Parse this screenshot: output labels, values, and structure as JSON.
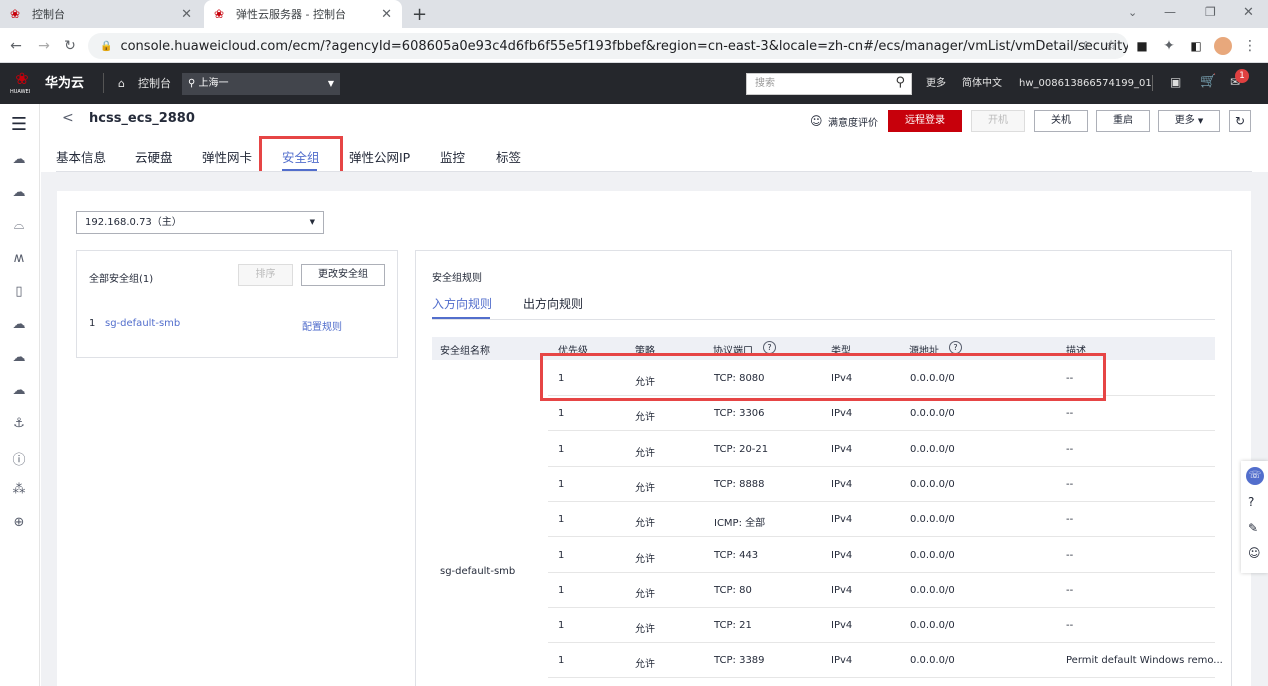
{
  "browser": {
    "tabs": [
      {
        "title": "控制台"
      },
      {
        "title": "弹性云服务器 - 控制台"
      }
    ],
    "url": "console.huaweicloud.com/ecm/?agencyId=608605a0e93c4d6fb6f55e5f193fbbef&region=cn-east-3&locale=zh-cn#/ecs/manager/vmList/vmDetail/securitygroups?instanc..."
  },
  "topnav": {
    "logo_text": "华为云",
    "logo_sub": "HUAWEI",
    "console": "控制台",
    "region": "上海一",
    "search_placeholder": "搜索",
    "more": "更多",
    "language": "简体中文",
    "username": "hw_008613866574199_01",
    "notif_count": "1"
  },
  "header": {
    "back": "<",
    "title": "hcss_ecs_2880",
    "satisfaction": "满意度评价",
    "remote_login": "远程登录",
    "power_on": "开机",
    "power_off": "关机",
    "restart": "重启",
    "more": "更多"
  },
  "tabs": [
    "基本信息",
    "云硬盘",
    "弹性网卡",
    "安全组",
    "弹性公网IP",
    "监控",
    "标签"
  ],
  "active_tab": "安全组",
  "nic_select": "192.168.0.73（主）",
  "left_panel": {
    "title": "全部安全组(1)",
    "sort_btn": "排序",
    "change_btn": "更改安全组",
    "group_index": "1",
    "group_name": "sg-default-smb",
    "config_link": "配置规则"
  },
  "rules_panel": {
    "title": "安全组规则",
    "tab_inbound": "入方向规则",
    "tab_outbound": "出方向规则",
    "columns": [
      "安全组名称",
      "优先级",
      "策略",
      "协议端口",
      "类型",
      "源地址",
      "描述"
    ],
    "group_name": "sg-default-smb",
    "rows": [
      {
        "priority": "1",
        "policy": "允许",
        "port": "TCP: 8080",
        "type": "IPv4",
        "source": "0.0.0.0/0",
        "desc": "--"
      },
      {
        "priority": "1",
        "policy": "允许",
        "port": "TCP: 3306",
        "type": "IPv4",
        "source": "0.0.0.0/0",
        "desc": "--"
      },
      {
        "priority": "1",
        "policy": "允许",
        "port": "TCP: 20-21",
        "type": "IPv4",
        "source": "0.0.0.0/0",
        "desc": "--"
      },
      {
        "priority": "1",
        "policy": "允许",
        "port": "TCP: 8888",
        "type": "IPv4",
        "source": "0.0.0.0/0",
        "desc": "--"
      },
      {
        "priority": "1",
        "policy": "允许",
        "port": "ICMP: 全部",
        "type": "IPv4",
        "source": "0.0.0.0/0",
        "desc": "--"
      },
      {
        "priority": "1",
        "policy": "允许",
        "port": "TCP: 443",
        "type": "IPv4",
        "source": "0.0.0.0/0",
        "desc": "--"
      },
      {
        "priority": "1",
        "policy": "允许",
        "port": "TCP: 80",
        "type": "IPv4",
        "source": "0.0.0.0/0",
        "desc": "--"
      },
      {
        "priority": "1",
        "policy": "允许",
        "port": "TCP: 21",
        "type": "IPv4",
        "source": "0.0.0.0/0",
        "desc": "--"
      },
      {
        "priority": "1",
        "policy": "允许",
        "port": "TCP: 3389",
        "type": "IPv4",
        "source": "0.0.0.0/0",
        "desc": "Permit default Windows remo..."
      }
    ]
  },
  "colors": {
    "brand_red": "#c7000b",
    "link_blue": "#526ecc",
    "highlight": "#e64545"
  }
}
